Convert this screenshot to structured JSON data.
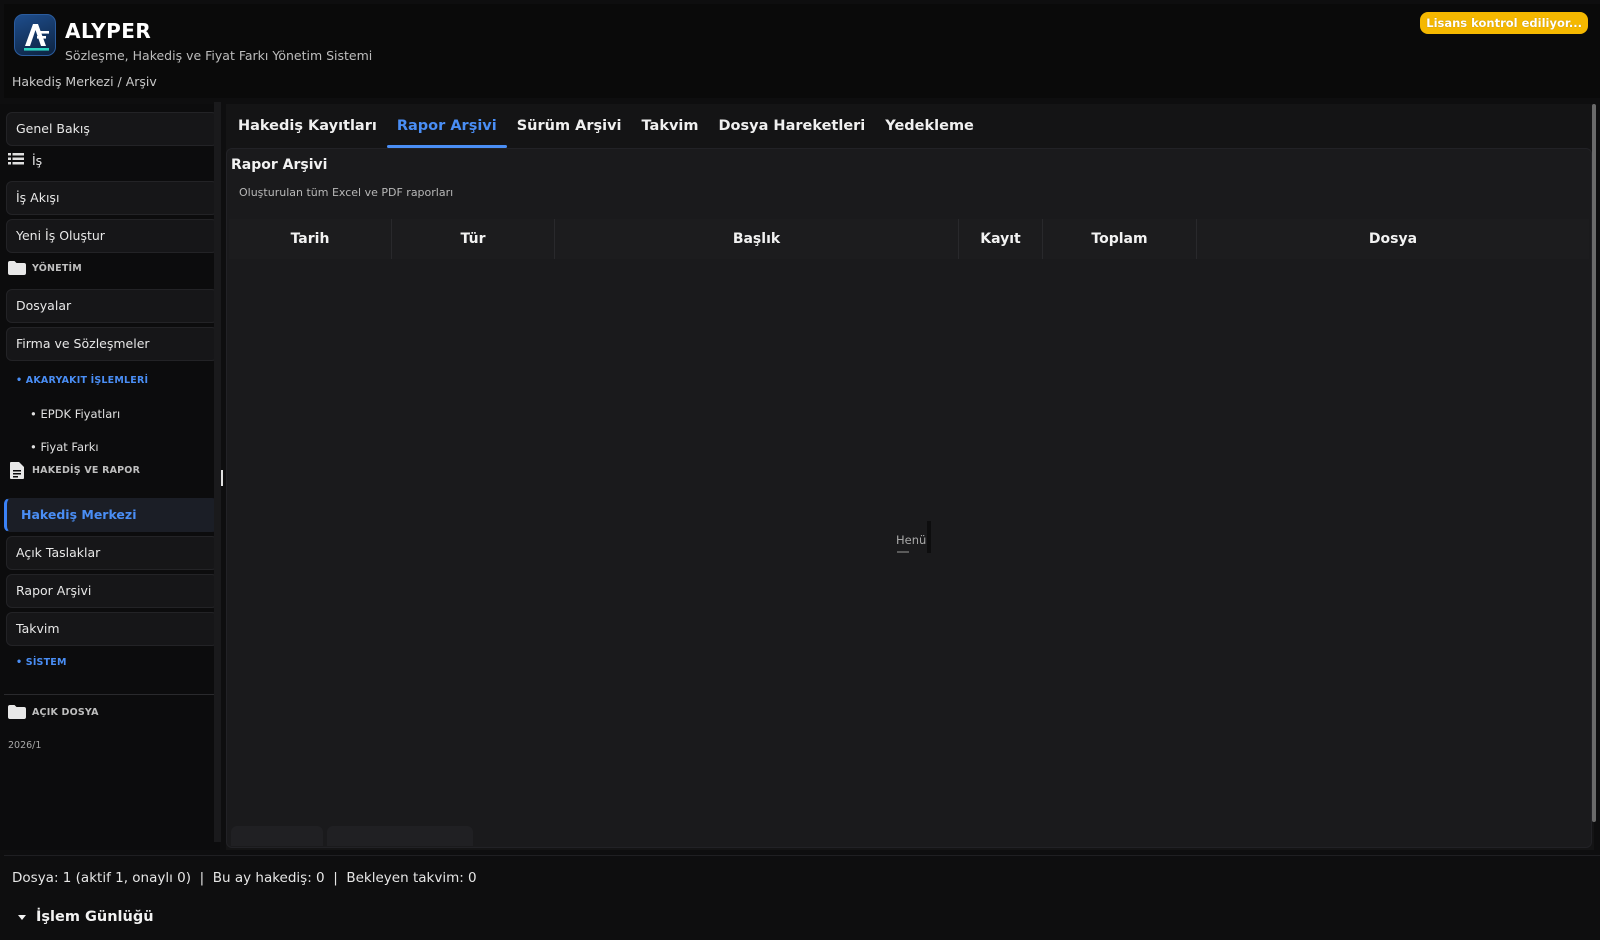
{
  "header": {
    "app_title": "ALYPER",
    "app_subtitle": "Sözleşme, Hakediş ve Fiyat Farkı Yönetim Sistemi",
    "breadcrumb": "Hakediş Merkezi / Arşiv",
    "license_status": "Lisans kontrol ediliyor..."
  },
  "sidebar": {
    "overview": "Genel Bakış",
    "is_section": "İş",
    "workflow": "İş Akışı",
    "new_job": "Yeni İş Oluştur",
    "management_section": "YÖNETİM",
    "files": "Dosyalar",
    "firms_contracts": "Firma ve Sözleşmeler",
    "fuel_section": "• AKARYAKIT İŞLEMLERİ",
    "epdk_prices": "• EPDK Fiyatları",
    "price_difference": "• Fiyat Farkı",
    "report_section": "HAKEDİŞ VE RAPOR",
    "progress_center": "Hakediş Merkezi",
    "open_drafts": "Açık Taslaklar",
    "report_archive": "Rapor Arşivi",
    "calendar": "Takvim",
    "system_section": "• SİSTEM",
    "open_file_section": "AÇIK DOSYA",
    "open_file_value": "2026/1"
  },
  "tabs": [
    {
      "label": "Hakediş Kayıtları",
      "active": false
    },
    {
      "label": "Rapor Arşivi",
      "active": true
    },
    {
      "label": "Sürüm Arşivi",
      "active": false
    },
    {
      "label": "Takvim",
      "active": false
    },
    {
      "label": "Dosya Hareketleri",
      "active": false
    },
    {
      "label": "Yedekleme",
      "active": false
    }
  ],
  "panel": {
    "title": "Rapor Arşivi",
    "description": "Oluşturulan tüm Excel ve PDF raporları",
    "columns": [
      "Tarih",
      "Tür",
      "Başlık",
      "Kayıt",
      "Toplam",
      "Dosya"
    ],
    "empty_text": "Henü"
  },
  "status_bar": "Dosya: 1 (aktif 1, onaylı 0)  |  Bu ay hakediş: 0  |  Bekleyen takvim: 0",
  "log": {
    "label": "İşlem Günlüğü"
  },
  "colors": {
    "accent": "#4a8ef5",
    "license_badge": "#f5b800",
    "background": "#0e0e0f"
  }
}
